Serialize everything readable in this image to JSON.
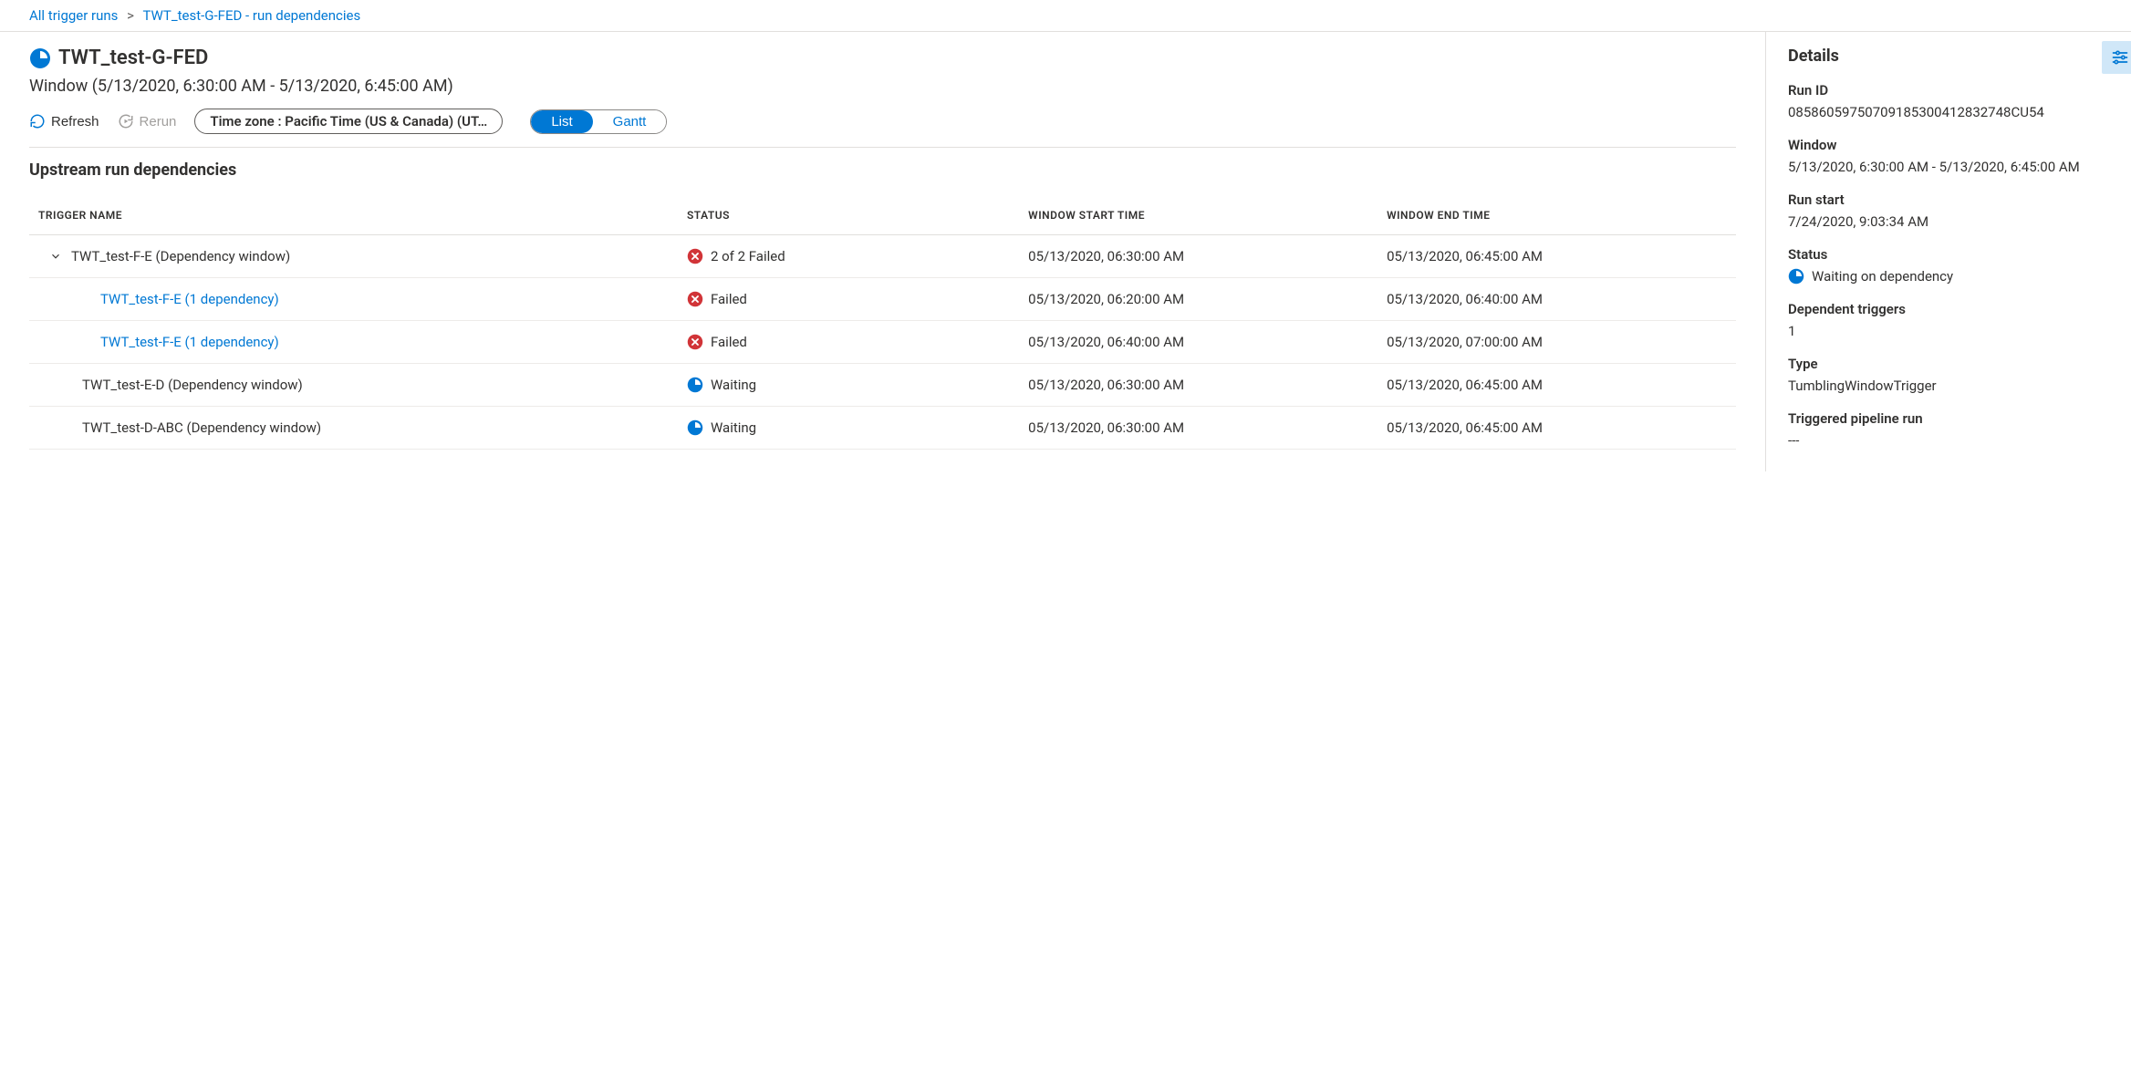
{
  "breadcrumb": {
    "root": "All trigger runs",
    "current": "TWT_test-G-FED - run dependencies"
  },
  "header": {
    "title": "TWT_test-G-FED",
    "window_subtitle": "Window (5/13/2020, 6:30:00 AM - 5/13/2020, 6:45:00 AM)"
  },
  "toolbar": {
    "refresh": "Refresh",
    "rerun": "Rerun",
    "timezone": "Time zone : Pacific Time (US & Canada) (UT…",
    "view_list": "List",
    "view_gantt": "Gantt"
  },
  "section": {
    "title": "Upstream run dependencies"
  },
  "table": {
    "headers": {
      "trigger": "TRIGGER NAME",
      "status": "STATUS",
      "start": "WINDOW START TIME",
      "end": "WINDOW END TIME"
    },
    "rows": [
      {
        "indent": 1,
        "expandable": true,
        "link": false,
        "name": "TWT_test-F-E (Dependency window)",
        "status_icon": "fail",
        "status_text": "2 of 2 Failed",
        "start": "05/13/2020, 06:30:00 AM",
        "end": "05/13/2020, 06:45:00 AM"
      },
      {
        "indent": 2,
        "expandable": false,
        "link": true,
        "name": "TWT_test-F-E (1 dependency)",
        "status_icon": "fail",
        "status_text": "Failed",
        "start": "05/13/2020, 06:20:00 AM",
        "end": "05/13/2020, 06:40:00 AM"
      },
      {
        "indent": 2,
        "expandable": false,
        "link": true,
        "name": "TWT_test-F-E (1 dependency)",
        "status_icon": "fail",
        "status_text": "Failed",
        "start": "05/13/2020, 06:40:00 AM",
        "end": "05/13/2020, 07:00:00 AM"
      },
      {
        "indent": 1,
        "expandable": false,
        "link": false,
        "name": "TWT_test-E-D (Dependency window)",
        "status_icon": "waiting",
        "status_text": "Waiting",
        "start": "05/13/2020, 06:30:00 AM",
        "end": "05/13/2020, 06:45:00 AM"
      },
      {
        "indent": 1,
        "expandable": false,
        "link": false,
        "name": "TWT_test-D-ABC (Dependency window)",
        "status_icon": "waiting",
        "status_text": "Waiting",
        "start": "05/13/2020, 06:30:00 AM",
        "end": "05/13/2020, 06:45:00 AM"
      }
    ]
  },
  "details": {
    "title": "Details",
    "labels": {
      "run_id": "Run ID",
      "window": "Window",
      "run_start": "Run start",
      "status": "Status",
      "dependent_triggers": "Dependent triggers",
      "type": "Type",
      "triggered_pipeline_run": "Triggered pipeline run"
    },
    "values": {
      "run_id": "08586059750709185300412832748CU54",
      "window": "5/13/2020, 6:30:00 AM - 5/13/2020, 6:45:00 AM",
      "run_start": "7/24/2020, 9:03:34 AM",
      "status": "Waiting on dependency",
      "dependent_triggers": "1",
      "type": "TumblingWindowTrigger",
      "triggered_pipeline_run": "---"
    }
  }
}
